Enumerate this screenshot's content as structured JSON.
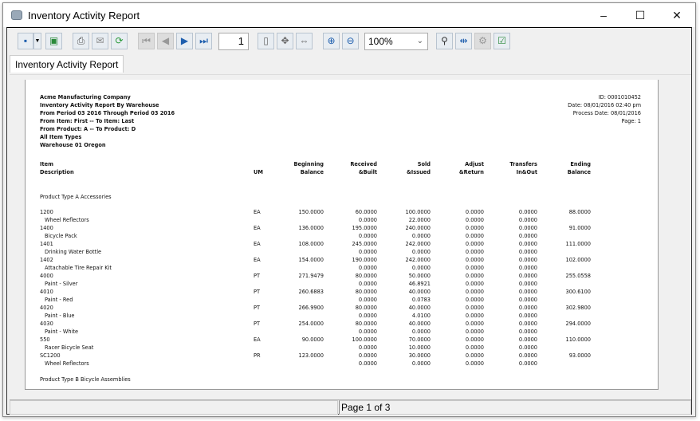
{
  "window": {
    "title": "Inventory Activity Report",
    "minimize": "–",
    "maximize": "☐",
    "close": "✕"
  },
  "toolbar": {
    "page_number": "1",
    "zoom": "100%",
    "icons": [
      "save-icon",
      "dropdown-icon",
      "export-image-icon",
      "print-icon",
      "email-icon",
      "refresh-icon",
      "first-page-icon",
      "prev-page-icon",
      "next-page-icon",
      "last-page-icon",
      "page-icon",
      "fit-page-icon",
      "fit-width-icon",
      "zoom-in-icon",
      "zoom-out-icon",
      "find-icon",
      "page-setup-icon",
      "settings-icon",
      "parameters-icon"
    ]
  },
  "tab": {
    "label": "Inventory Activity Report"
  },
  "report": {
    "header_left": [
      "Acme Manufacturing Company",
      "Inventory Activity Report By Warehouse",
      "From Period 03 2016 Through Period 03 2016",
      "From Item: First -- To Item: Last",
      "From Product: A   -- To Product: D",
      "All Item Types",
      "Warehouse 01 Oregon"
    ],
    "header_right": [
      "ID: 0001010452",
      "Date: 08/01/2016 02:40 pm",
      "Process Date: 08/01/2016",
      "Page: 1"
    ],
    "columns": {
      "item": [
        "Item",
        "Description"
      ],
      "um": "UM",
      "beginning": [
        "Beginning",
        "Balance"
      ],
      "received": [
        "Received",
        "&Built"
      ],
      "sold": [
        "Sold",
        "&Issued"
      ],
      "adjust": [
        "Adjust",
        "&Return"
      ],
      "transfers": [
        "Transfers",
        "In&Out"
      ],
      "ending": [
        "Ending",
        "Balance"
      ]
    },
    "group_a": "Product Type A   Accessories",
    "group_b": "Product Type B   Bicycle Assemblies",
    "rows": [
      {
        "item": "1200",
        "desc": "Wheel Reflectors",
        "um": "EA",
        "beg": "150.0000",
        "rec": "60.0000",
        "sold": "100.0000",
        "adj": "0.0000",
        "tr": "0.0000",
        "end": "88.0000",
        "rec2": "0.0000",
        "sold2": "22.0000",
        "adj2": "0.0000",
        "tr2": "0.0000"
      },
      {
        "item": "1400",
        "desc": "Bicycle Pack",
        "um": "EA",
        "beg": "136.0000",
        "rec": "195.0000",
        "sold": "240.0000",
        "adj": "0.0000",
        "tr": "0.0000",
        "end": "91.0000",
        "rec2": "0.0000",
        "sold2": "0.0000",
        "adj2": "0.0000",
        "tr2": "0.0000"
      },
      {
        "item": "1401",
        "desc": "Drinking Water Bottle",
        "um": "EA",
        "beg": "108.0000",
        "rec": "245.0000",
        "sold": "242.0000",
        "adj": "0.0000",
        "tr": "0.0000",
        "end": "111.0000",
        "rec2": "0.0000",
        "sold2": "0.0000",
        "adj2": "0.0000",
        "tr2": "0.0000"
      },
      {
        "item": "1402",
        "desc": "Attachable Tire Repair Kit",
        "um": "EA",
        "beg": "154.0000",
        "rec": "190.0000",
        "sold": "242.0000",
        "adj": "0.0000",
        "tr": "0.0000",
        "end": "102.0000",
        "rec2": "0.0000",
        "sold2": "0.0000",
        "adj2": "0.0000",
        "tr2": "0.0000"
      },
      {
        "item": "4000",
        "desc": "Paint - Silver",
        "um": "PT",
        "beg": "271.9479",
        "rec": "80.0000",
        "sold": "50.0000",
        "adj": "0.0000",
        "tr": "0.0000",
        "end": "255.0558",
        "rec2": "0.0000",
        "sold2": "46.8921",
        "adj2": "0.0000",
        "tr2": "0.0000"
      },
      {
        "item": "4010",
        "desc": "Paint - Red",
        "um": "PT",
        "beg": "260.6883",
        "rec": "80.0000",
        "sold": "40.0000",
        "adj": "0.0000",
        "tr": "0.0000",
        "end": "300.6100",
        "rec2": "0.0000",
        "sold2": "0.0783",
        "adj2": "0.0000",
        "tr2": "0.0000"
      },
      {
        "item": "4020",
        "desc": "Paint - Blue",
        "um": "PT",
        "beg": "266.9900",
        "rec": "80.0000",
        "sold": "40.0000",
        "adj": "0.0000",
        "tr": "0.0000",
        "end": "302.9800",
        "rec2": "0.0000",
        "sold2": "4.0100",
        "adj2": "0.0000",
        "tr2": "0.0000"
      },
      {
        "item": "4030",
        "desc": "Paint - White",
        "um": "PT",
        "beg": "254.0000",
        "rec": "80.0000",
        "sold": "40.0000",
        "adj": "0.0000",
        "tr": "0.0000",
        "end": "294.0000",
        "rec2": "0.0000",
        "sold2": "0.0000",
        "adj2": "0.0000",
        "tr2": "0.0000"
      },
      {
        "item": "550",
        "desc": "Racer Bicycle Seat",
        "um": "EA",
        "beg": "90.0000",
        "rec": "100.0000",
        "sold": "70.0000",
        "adj": "0.0000",
        "tr": "0.0000",
        "end": "110.0000",
        "rec2": "0.0000",
        "sold2": "10.0000",
        "adj2": "0.0000",
        "tr2": "0.0000"
      },
      {
        "item": "SC1200",
        "desc": "Wheel Reflectors",
        "um": "PR",
        "beg": "123.0000",
        "rec": "0.0000",
        "sold": "30.0000",
        "adj": "0.0000",
        "tr": "0.0000",
        "end": "93.0000",
        "rec2": "0.0000",
        "sold2": "0.0000",
        "adj2": "0.0000",
        "tr2": "0.0000"
      }
    ]
  },
  "status": {
    "page_info": "Page 1 of 3"
  }
}
